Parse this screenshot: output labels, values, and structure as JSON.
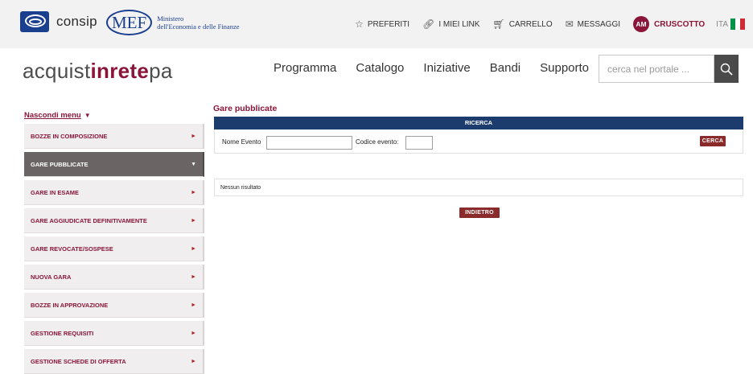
{
  "topbar": {
    "consip_label": "consip",
    "mef_label": "MEF",
    "mef_line1": "Ministero",
    "mef_line2": "dell'Economia e delle Finanze",
    "links": [
      {
        "label": "PREFERITI",
        "icon": "star-icon",
        "glyph": "☆"
      },
      {
        "label": "I MIEI LINK",
        "icon": "link-icon",
        "glyph": "🔗"
      },
      {
        "label": "CARRELLO",
        "icon": "cart-icon",
        "glyph": "🛒"
      },
      {
        "label": "MESSAGGI",
        "icon": "envelope-icon",
        "glyph": "✉"
      }
    ],
    "avatar_initials": "AM",
    "cruscotto_label": "CRUSCOTTO",
    "language": "ITA",
    "flag_colors": [
      "#009246",
      "#ffffff",
      "#ce2b37"
    ]
  },
  "header": {
    "brand_part1": "acquist",
    "brand_part2": "inrete",
    "brand_part3": "pa",
    "nav": [
      "Programma",
      "Catalogo",
      "Iniziative",
      "Bandi",
      "Supporto"
    ],
    "search_placeholder": "cerca nel portale ...",
    "search_icon": "magnifier-icon"
  },
  "sidebar": {
    "toggle_label": "Nascondi menu",
    "items": [
      {
        "label": "BOZZE IN COMPOSIZIONE",
        "active": false
      },
      {
        "label": "GARE PUBBLICATE",
        "active": true
      },
      {
        "label": "GARE IN ESAME",
        "active": false
      },
      {
        "label": "GARE AGGIUDICATE DEFINITIVAMENTE",
        "active": false
      },
      {
        "label": "GARE REVOCATE/SOSPESE",
        "active": false
      },
      {
        "label": "NUOVA GARA",
        "active": false
      },
      {
        "label": "BOZZE IN APPROVAZIONE",
        "active": false
      },
      {
        "label": "GESTIONE REQUISITI",
        "active": false
      },
      {
        "label": "GESTIONE SCHEDE DI OFFERTA",
        "active": false
      }
    ]
  },
  "content": {
    "title": "Gare pubblicate",
    "search_header": "RICERCA",
    "nome_evento_label": "Nome Evento",
    "nome_evento_value": "",
    "codice_evento_label": "Codice evento:",
    "codice_evento_value": "",
    "cerca_label": "CERCA",
    "no_results": "Nessun risultato",
    "back_label": "INDIETRO"
  },
  "colors": {
    "brand_red": "#8a1538",
    "navy": "#1c3c6e",
    "active_menu": "#6b6464",
    "button_red": "#8a2a2a"
  }
}
